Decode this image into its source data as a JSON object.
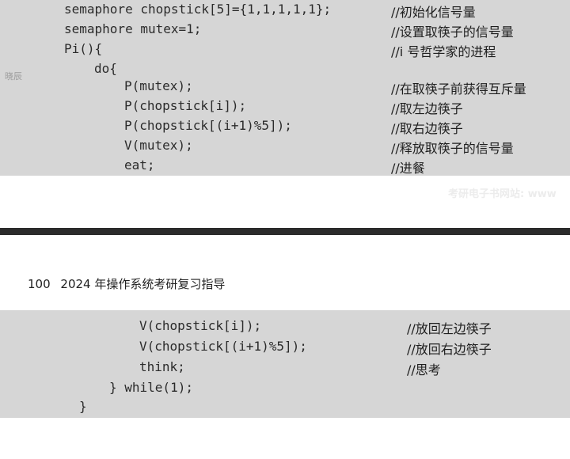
{
  "top_code": {
    "lines": [
      {
        "code": "semaphore chopstick[5]={1,1,1,1,1};",
        "comment": "//初始化信号量"
      },
      {
        "code": "semaphore mutex=1;",
        "comment": "//设置取筷子的信号量"
      },
      {
        "code": "Pi(){",
        "comment": "//i 号哲学家的进程"
      },
      {
        "code": "do{",
        "comment": ""
      },
      {
        "code": "P(mutex);",
        "comment": "//在取筷子前获得互斥量"
      },
      {
        "code": "P(chopstick[i]);",
        "comment": "//取左边筷子"
      },
      {
        "code": "P(chopstick[(i+1)%5]);",
        "comment": "//取右边筷子"
      },
      {
        "code": "V(mutex);",
        "comment": "//释放取筷子的信号量"
      },
      {
        "code": "eat;",
        "comment": "//进餐"
      }
    ]
  },
  "scan_mark": "晓辰",
  "watermark": "考研电子书网站: www",
  "page_header": {
    "page_number": "100",
    "title": "2024 年操作系统考研复习指导"
  },
  "bottom_code": {
    "lines": [
      {
        "code": "V(chopstick[i]);",
        "comment": "//放回左边筷子"
      },
      {
        "code": "V(chopstick[(i+1)%5]);",
        "comment": "//放回右边筷子"
      },
      {
        "code": "think;",
        "comment": "//思考"
      },
      {
        "code": "} while(1);",
        "comment": ""
      },
      {
        "code": "}",
        "comment": ""
      }
    ]
  }
}
